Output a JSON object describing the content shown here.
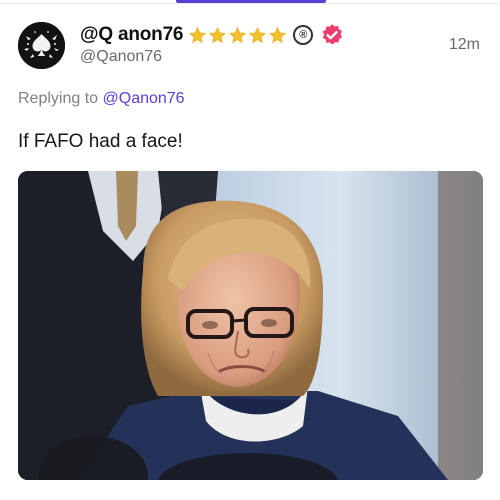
{
  "post": {
    "display_name": "@Q anon76",
    "registered_mark": "®",
    "handle": "@Qanon76",
    "timestamp": "12m",
    "reply_prefix": "Replying to",
    "reply_handle": "@Qanon76",
    "text": "If FAFO had a face!"
  },
  "badges": {
    "stars": [
      "star-icon",
      "star-icon",
      "star-icon",
      "star-icon",
      "star-icon"
    ],
    "verified_icon": "verified-badge-icon",
    "star_color": "#f4c030",
    "verified_color": "#ec3d6e"
  },
  "colors": {
    "accent": "#5b3ed8",
    "secondary_text": "#666a70"
  }
}
